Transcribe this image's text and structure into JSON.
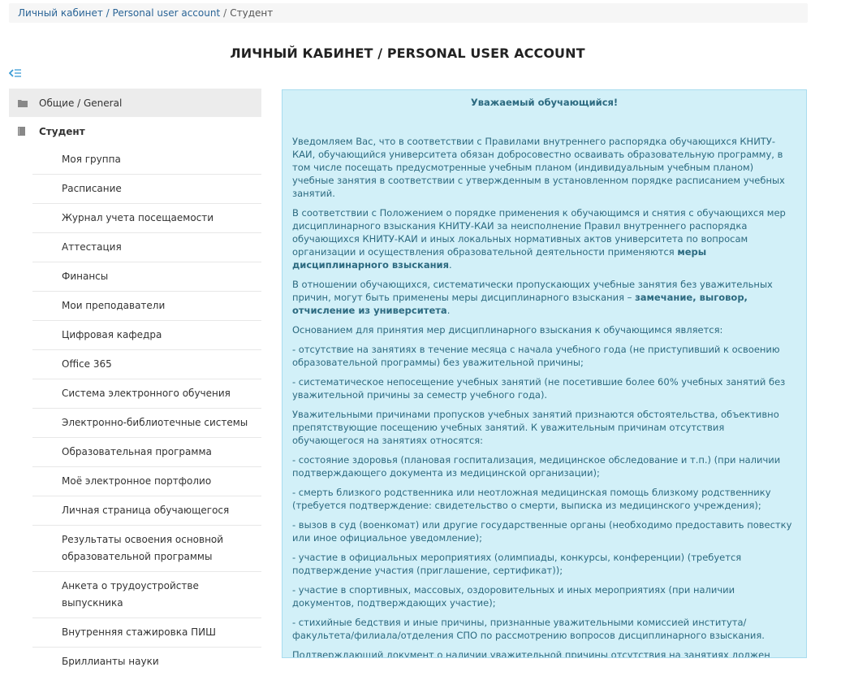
{
  "breadcrumb": {
    "items": [
      "Личный кабинет / Personal user account",
      "Студент"
    ],
    "separator": "/"
  },
  "page_title": "ЛИЧНЫЙ КАБИНЕТ / PERSONAL USER ACCOUNT",
  "sidebar": {
    "toggle_icon": "collapse-menu-icon",
    "sections": [
      {
        "label": "Общие / General",
        "icon": "folder-icon",
        "active": true
      },
      {
        "label": "Студент",
        "icon": "book-icon",
        "active": false
      }
    ],
    "items": [
      "Моя группа",
      "Расписание",
      "Журнал учета посещаемости",
      "Аттестация",
      "Финансы",
      "Мои преподаватели",
      "Цифровая кафедра",
      "Office 365",
      "Система электронного обучения",
      "Электронно-библиотечные системы",
      "Образовательная программа",
      "Моё электронное портфолио",
      "Личная страница обучающегося",
      "Результаты освоения основной образовательной программы",
      "Анкета о трудоустройстве выпускника",
      "Внутренняя стажировка ПИШ",
      "Бриллианты науки"
    ]
  },
  "notice": {
    "title": "Уважаемый обучающийся!",
    "p1": "Уведомляем Вас, что в соответствии с Правилами внутреннего распорядка обучающихся КНИТУ-КАИ, обучающийся университета обязан добросовестно осваивать образовательную программу, в том числе посещать предусмотренные учебным планом (индивидуальным учебным планом) учебные занятия в соответствии с утвержденным в установленном порядке расписанием учебных занятий.",
    "p2_text": "В соответствии с Положением о порядке применения к обучающимся и снятия с обучающихся мер дисциплинарного взыскания КНИТУ-КАИ за неисполнение Правил внутреннего распорядка обучающихся КНИТУ-КАИ и иных локальных нормативных актов университета по вопросам организации и осуществления образовательной деятельности применяются",
    "p2_bold": "меры дисциплинарного взыскания",
    "p2_end": ".",
    "p3_text": "В отношении обучающихся, систематически пропускающих учебные занятия без уважительных причин, могут быть применены меры дисциплинарного взыскания –",
    "p3_bold": "замечание, выговор, отчисление из университета",
    "p3_end": ".",
    "p4": "Основанием для принятия мер дисциплинарного взыскания к обучающимся является:",
    "p5": "- отсутствие на занятиях в течение месяца с начала учебного года (не приступивший к освоению образовательной программы) без уважительной причины;",
    "p6": "- систематическое непосещение учебных занятий (не посетившие более 60% учебных занятий без уважительной причины за семестр учебного года).",
    "p7": "Уважительными причинами пропусков учебных занятий признаются обстоятельства, объективно препятствующие посещению учебных занятий. К уважительным причинам отсутствия обучающегося на занятиях относятся:",
    "p8": "- состояние здоровья (плановая госпитализация, медицинское обследование и т.п.) (при наличии подтверждающего документа из медицинской организации);",
    "p9": "- смерть близкого родственника или неотложная медицинская помощь близкому родственнику (требуется подтверждение: свидетельство о смерти, выписка из медицинского учреждения);",
    "p10": "- вызов в суд (военкомат) или другие государственные органы (необходимо предоставить повестку или иное официальное уведомление);",
    "p11": "- участие в официальных мероприятиях (олимпиады, конкурсы, конференции) (требуется подтверждение участия (приглашение, сертификат));",
    "p12": "- участие в спортивных, массовых, оздоровительных и иных мероприятиях (при наличии документов, подтверждающих участие);",
    "p13": "- стихийные бедствия  и иные причины, признанные уважительными комиссией института/факультета/филиала/отделения СПО по рассмотрению вопросов дисциплинарного взыскания.",
    "p14": "Подтверждающий документ о наличии уважительной причины отсутствия на занятиях должен быть предоставлен обучающимся в дирекцию института/филиала/отделения СПО/деканат факультета не позднее"
  },
  "colors": {
    "notice_bg": "#d2f0f8",
    "notice_text": "#2c6a80",
    "link": "#2a6496",
    "toggle": "#3a9bd5"
  }
}
